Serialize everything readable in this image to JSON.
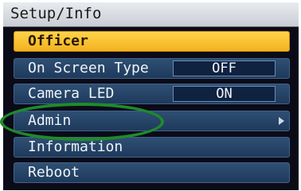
{
  "menu": {
    "title": "Setup/Info",
    "items": [
      {
        "label": "Officer",
        "selected": true
      },
      {
        "label": "On Screen Type",
        "value": "OFF"
      },
      {
        "label": "Camera LED",
        "value": "ON"
      },
      {
        "label": "Admin",
        "submenu_icon": "chevron-right-icon"
      },
      {
        "label": "Information"
      },
      {
        "label": "Reboot"
      }
    ]
  },
  "colors": {
    "selected_item": "#f3b21f",
    "item_background": "#1e3a5c",
    "highlight_annotation": "#1f8b2a"
  }
}
